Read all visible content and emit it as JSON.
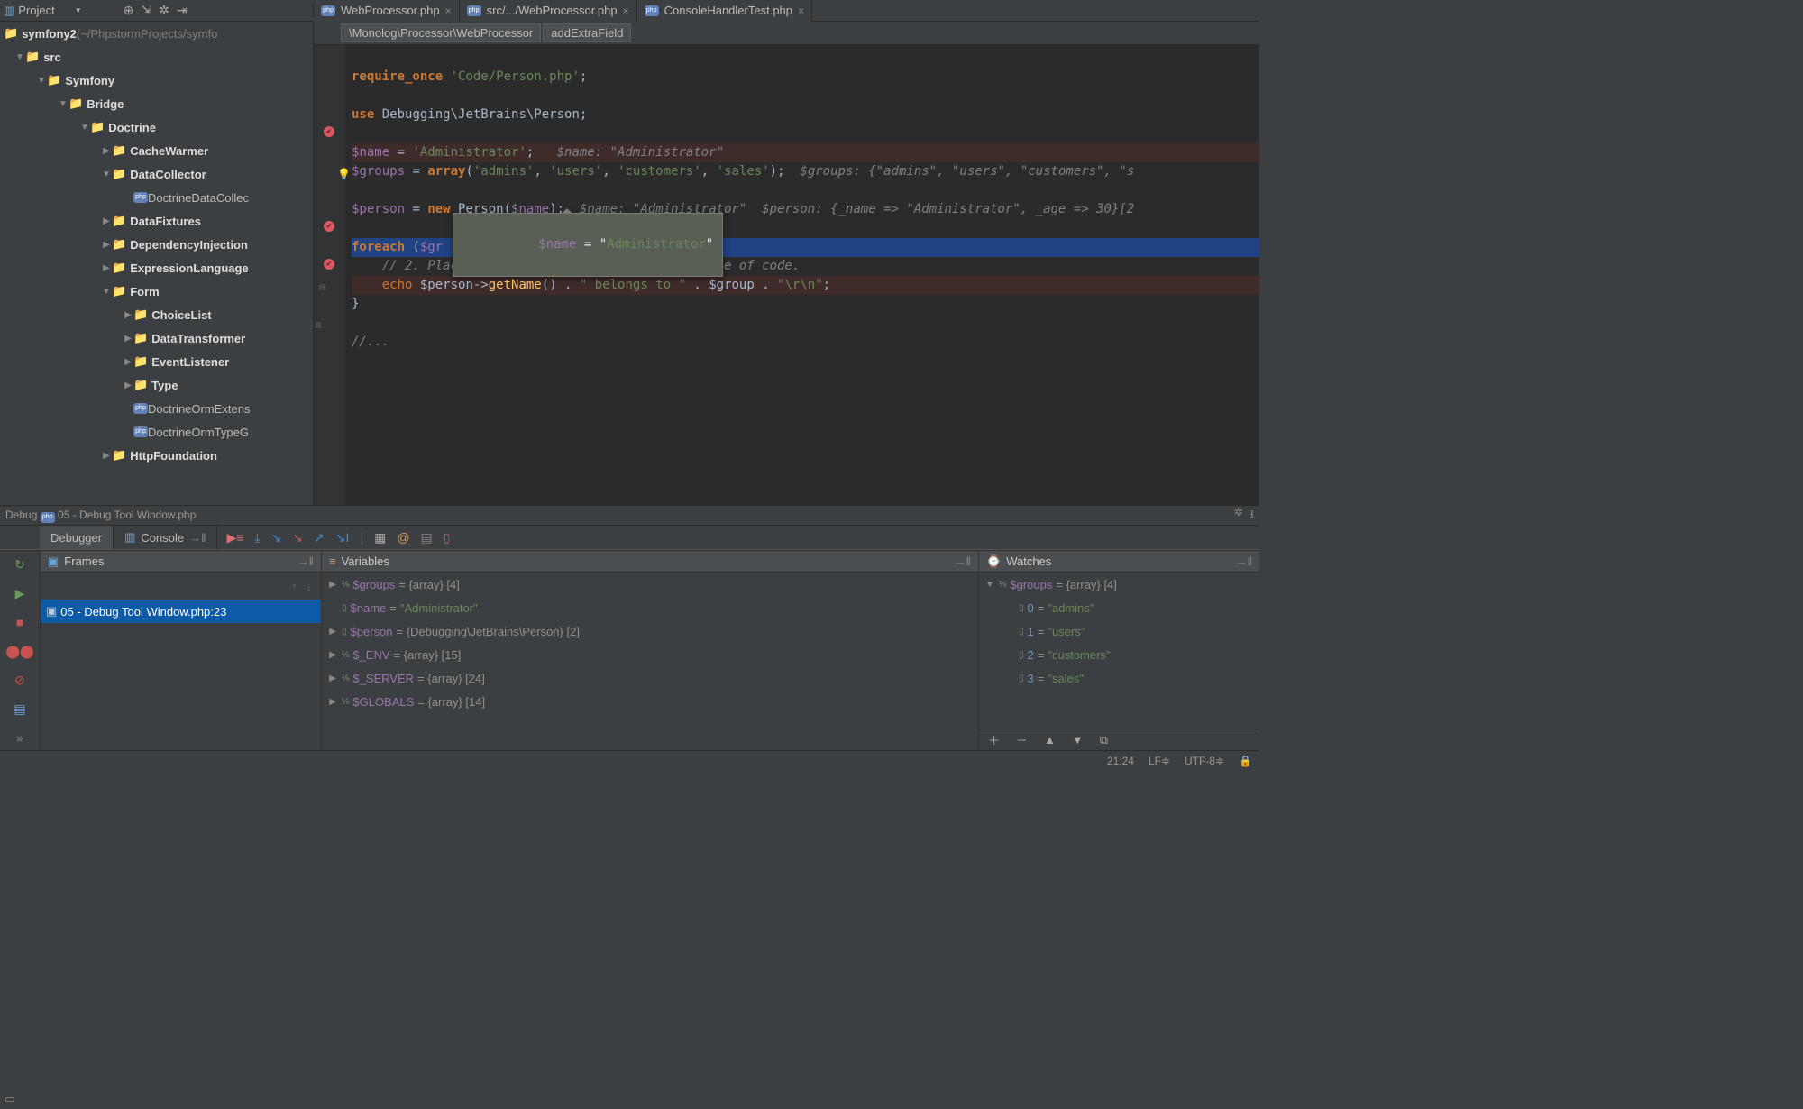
{
  "toolbar": {
    "project_label": "Project"
  },
  "tabs": [
    {
      "label": "WebProcessor.php",
      "active": false
    },
    {
      "label": "src/.../WebProcessor.php",
      "active": false
    },
    {
      "label": "ConsoleHandlerTest.php",
      "active": false
    }
  ],
  "breadcrumb": {
    "a": "\\Monolog\\Processor\\WebProcessor",
    "b": "addExtraField"
  },
  "tree": {
    "root": "symfony2",
    "root_suffix": " (~/PhpstormProjects/symfo",
    "items": [
      {
        "depth": 0,
        "arrow": "▼",
        "icon": "📁",
        "label": "src",
        "bold": true
      },
      {
        "depth": 1,
        "arrow": "▼",
        "icon": "📁",
        "label": "Symfony",
        "bold": true
      },
      {
        "depth": 2,
        "arrow": "▼",
        "icon": "📁",
        "label": "Bridge",
        "bold": true
      },
      {
        "depth": 3,
        "arrow": "▼",
        "icon": "📁",
        "label": "Doctrine",
        "bold": true
      },
      {
        "depth": 4,
        "arrow": "▶",
        "icon": "📁",
        "label": "CacheWarmer",
        "bold": true
      },
      {
        "depth": 4,
        "arrow": "▼",
        "icon": "📁",
        "label": "DataCollector",
        "bold": true
      },
      {
        "depth": 5,
        "arrow": "",
        "icon": "php",
        "label": "DoctrineDataCollec"
      },
      {
        "depth": 4,
        "arrow": "▶",
        "icon": "📁",
        "label": "DataFixtures",
        "bold": true
      },
      {
        "depth": 4,
        "arrow": "▶",
        "icon": "📁",
        "label": "DependencyInjection",
        "bold": true
      },
      {
        "depth": 4,
        "arrow": "▶",
        "icon": "📁",
        "label": "ExpressionLanguage",
        "bold": true
      },
      {
        "depth": 4,
        "arrow": "▼",
        "icon": "📁",
        "label": "Form",
        "bold": true
      },
      {
        "depth": 5,
        "arrow": "▶",
        "icon": "📁",
        "label": "ChoiceList",
        "bold": true
      },
      {
        "depth": 5,
        "arrow": "▶",
        "icon": "📁",
        "label": "DataTransformer",
        "bold": true
      },
      {
        "depth": 5,
        "arrow": "▶",
        "icon": "📁",
        "label": "EventListener",
        "bold": true
      },
      {
        "depth": 5,
        "arrow": "▶",
        "icon": "📁",
        "label": "Type",
        "bold": true
      },
      {
        "depth": 5,
        "arrow": "",
        "icon": "php",
        "label": "DoctrineOrmExtens"
      },
      {
        "depth": 5,
        "arrow": "",
        "icon": "php",
        "label": "DoctrineOrmTypeG"
      },
      {
        "depth": 4,
        "arrow": "▶",
        "icon": "📁",
        "label": "HttpFoundation",
        "bold": true
      }
    ]
  },
  "code": {
    "l1a": "require_once",
    "l1b": "'Code/Person.php'",
    "l1c": ";",
    "l2a": "use",
    "l2b": " Debugging\\JetBrains\\Person;",
    "l3a": "$name",
    "l3b": " = ",
    "l3c": "'Administrator'",
    "l3d": ";   ",
    "l3i": "$name: \"Administrator\"",
    "l4a": "$groups",
    "l4b": " = ",
    "l4c": "array",
    "l4d": "(",
    "l4e": "'admins'",
    "l4f": ", ",
    "l4g": "'users'",
    "l4h": ", ",
    "l4i": "'customers'",
    "l4j": ", ",
    "l4k": "'sales'",
    "l4l": ");  ",
    "l4m": "$groups: {\"admins\", \"users\", \"customers\", \"s",
    "l5a": "$person",
    "l5b": " = ",
    "l5c": "new",
    "l5d": " Person(",
    "l5e": "$name",
    "l5f": ");  ",
    "l5g": "$name: \"Administrator\"  $person: {_name => \"Administrator\", _age => 30}[2",
    "l6a": "foreach",
    "l6b": " (",
    "l6c": "$gr",
    "l7": "    // 2. Place a breakpoint on the following line of code.",
    "l8a": "    ",
    "l8b": "echo",
    "l8c": " $person->",
    "l8d": "getName",
    "l8e": "() . ",
    "l8f": "\" belongs to \"",
    "l8g": " . $group . ",
    "l8h": "\"\\r\\n\"",
    "l8i": ";",
    "l9": "}",
    "l10": "//...",
    "tooltip_var": "$name",
    "tooltip_eq": " = \"",
    "tooltip_val": "Administrator",
    "tooltip_end": "\""
  },
  "debug": {
    "title_prefix": "Debug ",
    "title": "05 - Debug Tool Window.php",
    "tab1": "Debugger",
    "tab2": "Console",
    "frames_title": "Frames",
    "frame0": "05 - Debug Tool Window.php:23",
    "vars_title": "Variables",
    "watches_title": "Watches",
    "vars": [
      {
        "name": "$groups",
        "val": " = {array} [4]",
        "arrow": true,
        "num": true
      },
      {
        "name": "$name",
        "val_eq": " = ",
        "str": "\"Administrator\"",
        "arrow": false
      },
      {
        "name": "$person",
        "val": " = {Debugging\\JetBrains\\Person} [2]",
        "arrow": true
      },
      {
        "name": "$_ENV",
        "val": " = {array} [15]",
        "arrow": true,
        "num": true
      },
      {
        "name": "$_SERVER",
        "val": " = {array} [24]",
        "arrow": true,
        "num": true
      },
      {
        "name": "$GLOBALS",
        "val": " = {array} [14]",
        "arrow": true,
        "num": true
      }
    ],
    "watches": {
      "root": {
        "name": "$groups",
        "val": " = {array} [4]"
      },
      "items": [
        {
          "k": "0",
          "v": "\"admins\""
        },
        {
          "k": "1",
          "v": "\"users\""
        },
        {
          "k": "2",
          "v": "\"customers\""
        },
        {
          "k": "3",
          "v": "\"sales\""
        }
      ]
    }
  },
  "status": {
    "pos": "21:24",
    "le": "LF≑",
    "enc": "UTF-8≑"
  }
}
